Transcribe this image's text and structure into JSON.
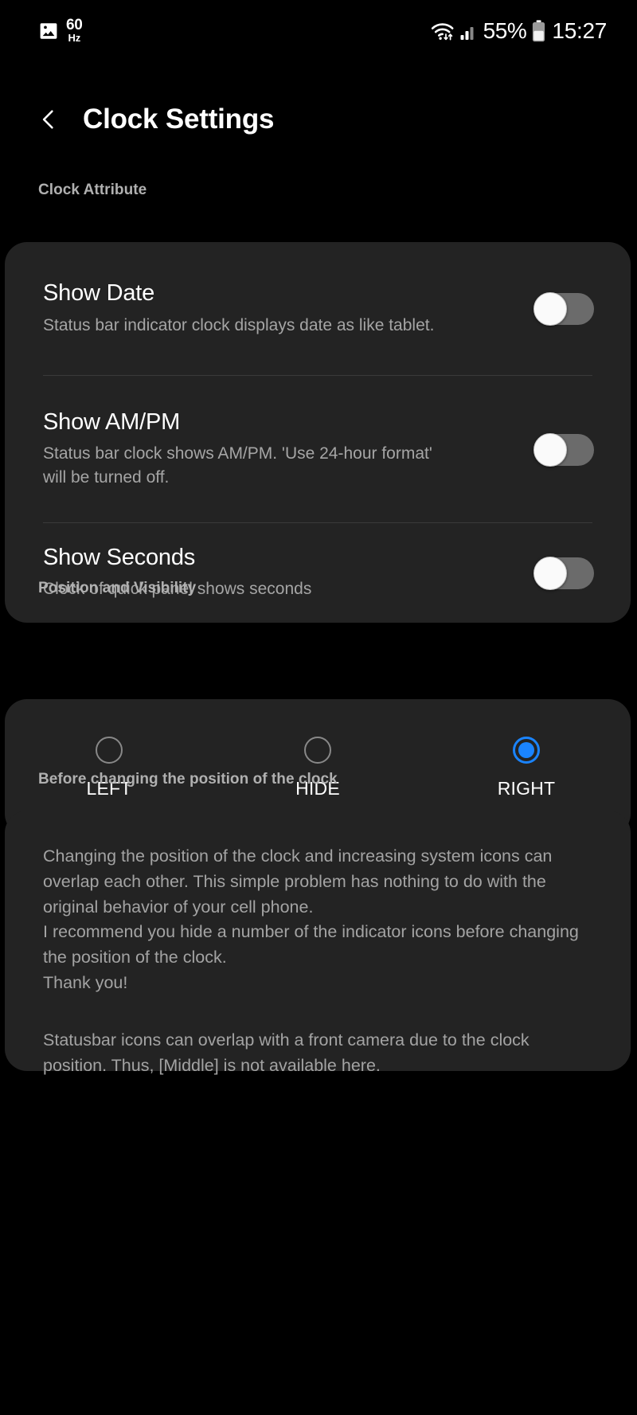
{
  "status_bar": {
    "left_icons": [
      {
        "name": "image-icon",
        "glyph": "image"
      },
      {
        "name": "refresh-rate-indicator",
        "value": "60",
        "unit": "Hz"
      }
    ],
    "refresh_rate_value": "60",
    "refresh_rate_unit": "Hz",
    "wifi_icon": "wifi-with-transfer-arrows",
    "signal_icon": "cellular-signal-bars",
    "battery_percent": "55%",
    "battery_icon": "battery-half",
    "time": "15:27"
  },
  "header": {
    "back_icon": "back-chevron-icon",
    "title": "Clock Settings"
  },
  "sections": {
    "clock_attribute": {
      "label": "Clock Attribute",
      "rows": [
        {
          "name": "show-date",
          "title": "Show Date",
          "subtitle": "Status bar indicator clock displays date as like tablet.",
          "toggle_state": "off"
        },
        {
          "name": "show-am-pm",
          "title": "Show AM/PM",
          "subtitle": "Status bar clock shows AM/PM. 'Use 24-hour format' will be turned off.",
          "toggle_state": "off"
        },
        {
          "name": "show-seconds",
          "title": "Show Seconds",
          "subtitle": "Clock of quick panel shows seconds",
          "toggle_state": "off"
        }
      ]
    },
    "position_and_visibility": {
      "label": "Position and Visibility",
      "options": [
        {
          "name": "left",
          "label": "LEFT",
          "selected": false
        },
        {
          "name": "hide",
          "label": "HIDE",
          "selected": false
        },
        {
          "name": "right",
          "label": "RIGHT",
          "selected": true
        }
      ],
      "selected_value": "RIGHT"
    },
    "before_changing": {
      "label": "Before changing the position of the clock",
      "paragraphs": [
        "Changing the position of the clock and increasing system icons can overlap each other. This simple problem has nothing to do with the original behavior of your cell phone.\n I recommend you hide a number of the indicator icons before changing the position of the clock.\n Thank you!",
        "Statusbar icons can overlap with a front camera due to the clock position. Thus, [Middle] is not available here."
      ]
    }
  },
  "colors": {
    "background": "#000000",
    "card": "#232323",
    "accent_blue": "#1a84ff",
    "primary_text": "#ffffff",
    "secondary_text": "#a3a3a3",
    "switch_track_off": "#6b6b6b"
  }
}
